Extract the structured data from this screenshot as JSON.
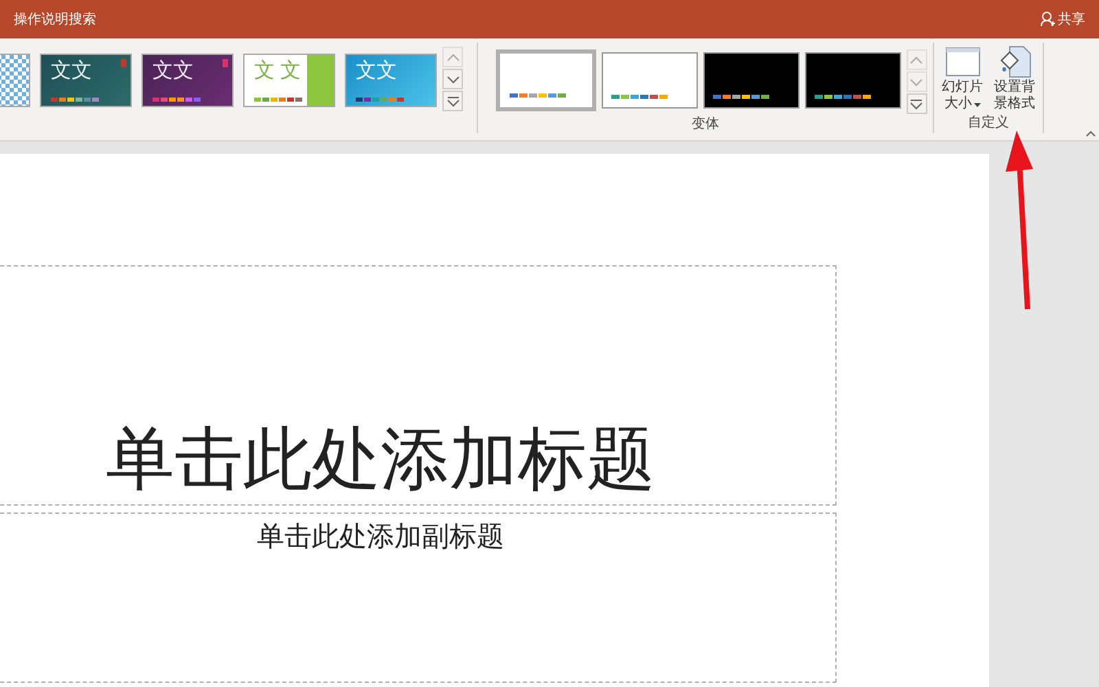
{
  "title_bar": {
    "search": "操作说明搜索",
    "share": "共享"
  },
  "ribbon": {
    "themes": [
      {
        "kind": "pattern"
      },
      {
        "kind": "teal",
        "sample": "文文"
      },
      {
        "kind": "purple",
        "sample": "文文"
      },
      {
        "kind": "green",
        "sample": "文 文"
      },
      {
        "kind": "blue",
        "sample": "文文"
      }
    ],
    "variants": {
      "label": "变体",
      "items": [
        {
          "kind": "light",
          "selected": true
        },
        {
          "kind": "light",
          "selected": false
        },
        {
          "kind": "dark",
          "selected": false
        },
        {
          "kind": "dark",
          "selected": false
        }
      ]
    },
    "customize": {
      "label": "自定义",
      "buttons": [
        {
          "kind": "slide-size",
          "lines": [
            "幻灯片",
            "大小"
          ]
        },
        {
          "kind": "background",
          "lines": [
            "设置背",
            "景格式"
          ]
        }
      ]
    }
  },
  "slide": {
    "title": "单击此处添加标题",
    "subtitle": "单击此处添加副标题"
  }
}
